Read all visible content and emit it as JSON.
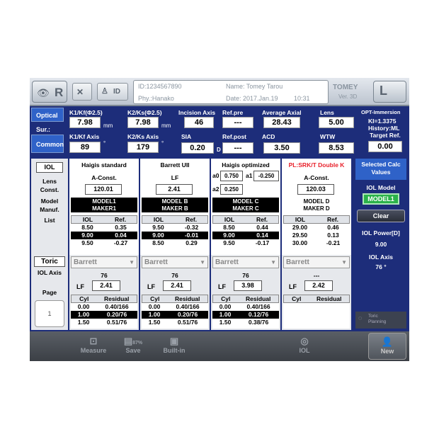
{
  "header": {
    "id_label": "ID:1234567890",
    "name": "Name: Tomey Tarou",
    "phy": "Phy.:Hanako",
    "date": "Date: 2017.Jan.19",
    "time": "10:31",
    "brand": "TOMEY",
    "version": "Ver. 3D",
    "id_btn": "ID",
    "eye": "R",
    "l_btn": "L"
  },
  "modes": [
    "Optical",
    "Sur.:",
    "Common"
  ],
  "params": {
    "k1_label": "K1/Kf(Φ2.5)",
    "k1": "7.98",
    "k1_unit": "mm",
    "k2_label": "K2/Ks(Φ2.5)",
    "k2": "7.98",
    "k2_unit": "mm",
    "incision_label": "Incision Axis",
    "incision": "46",
    "refpre_label": "Ref.pre",
    "refpre": "---",
    "axial_label": "Average Axial",
    "axial": "28.43",
    "lens_label": "Lens",
    "lens": "5.00",
    "k1axis_label": "K1/Kf Axis",
    "k1axis": "89",
    "k2axis_label": "K2/Ks Axis",
    "k2axis": "179",
    "sia_label": "SIA",
    "sia": "0.20",
    "sia_unit": "D",
    "refpost_label": "Ref.post",
    "refpost": "---",
    "acd_label": "ACD",
    "acd": "3.50",
    "wtw_label": "WTW",
    "wtw": "8.53",
    "immersion": "OPT-Immersion",
    "ki": "KI=1.3375",
    "history": "History:ML",
    "target_label": "Target Ref.",
    "target": "0.00"
  },
  "left_col": {
    "iol": "IOL",
    "lens_const": "Lens Const.",
    "model_manuf": "Model Manuf.",
    "list": "List",
    "toric": "Toric",
    "iol_axis": "IOL Axis",
    "page": "Page",
    "page_num": "1"
  },
  "formulas": [
    {
      "name": "Haigis standard",
      "const_label": "A-Const.",
      "const": "120.01",
      "model": "MODEL1",
      "maker": "MAKER1",
      "rows": [
        [
          "8.50",
          "0.35"
        ],
        [
          "9.00",
          "0.04"
        ],
        [
          "9.50",
          "-0.27"
        ]
      ],
      "toric": "Barrett",
      "axis": "76",
      "lf": "2.41",
      "toric_rows": [
        [
          "0.00",
          "0.40/166"
        ],
        [
          "1.00",
          "0.20/76"
        ],
        [
          "1.50",
          "0.51/76"
        ]
      ]
    },
    {
      "name": "Barrett UII",
      "const_label": "LF",
      "const": "2.41",
      "model": "MODEL B",
      "maker": "MAKER B",
      "rows": [
        [
          "9.50",
          "-0.32"
        ],
        [
          "9.00",
          "-0.01"
        ],
        [
          "8.50",
          "0.29"
        ]
      ],
      "toric": "Barrett",
      "axis": "76",
      "lf": "2.41",
      "toric_rows": [
        [
          "0.00",
          "0.40/166"
        ],
        [
          "1.00",
          "0.20/76"
        ],
        [
          "1.50",
          "0.51/76"
        ]
      ]
    },
    {
      "name": "Haigis optimized",
      "a0_label": "a0",
      "a0": "0.750",
      "a1_label": "a1",
      "a1": "-0.250",
      "a2_label": "a2",
      "a2": "0.250",
      "model": "MODEL C",
      "maker": "MAKER C",
      "rows": [
        [
          "8.50",
          "0.44"
        ],
        [
          "9.00",
          "0.14"
        ],
        [
          "9.50",
          "-0.17"
        ]
      ],
      "toric": "Barrett",
      "axis": "76",
      "lf": "3.98",
      "toric_rows": [
        [
          "0.00",
          "0.40/166"
        ],
        [
          "1.00",
          "0.12/76"
        ],
        [
          "1.50",
          "0.38/76"
        ]
      ]
    },
    {
      "name": "PL:SRK/T Double K",
      "const_label": "A-Const.",
      "const": "120.03",
      "model": "MODEL D",
      "maker": "MAKER D",
      "rows": [
        [
          "29.00",
          "0.46"
        ],
        [
          "29.50",
          "0.13"
        ],
        [
          "30.00",
          "-0.21"
        ]
      ],
      "toric": "Barrett",
      "axis": "---",
      "lf": "2.42",
      "toric_rows": []
    }
  ],
  "table_headers": {
    "iol": "IOL",
    "ref": "Ref.",
    "cyl": "Cyl",
    "residual": "Residual",
    "lf": "LF"
  },
  "right": {
    "selected": "Selected Calc Values",
    "iol_model_label": "IOL Model",
    "iol_model": "MODEL1",
    "clear": "Clear",
    "power_label": "IOL Power[D]",
    "power": "9.00",
    "axis_label": "IOL Axis",
    "axis": "76 °",
    "toric_planning": "Toric Planning"
  },
  "bottom": {
    "measure": "Measure",
    "save": "Save",
    "save_pct": "87%",
    "builtin": "Built-in",
    "iol": "IOL",
    "new": "New"
  },
  "colors": {
    "accent": "#1d2d7a",
    "active": "#2f62c8",
    "red": "#e8202a",
    "green": "#2bb24a"
  }
}
